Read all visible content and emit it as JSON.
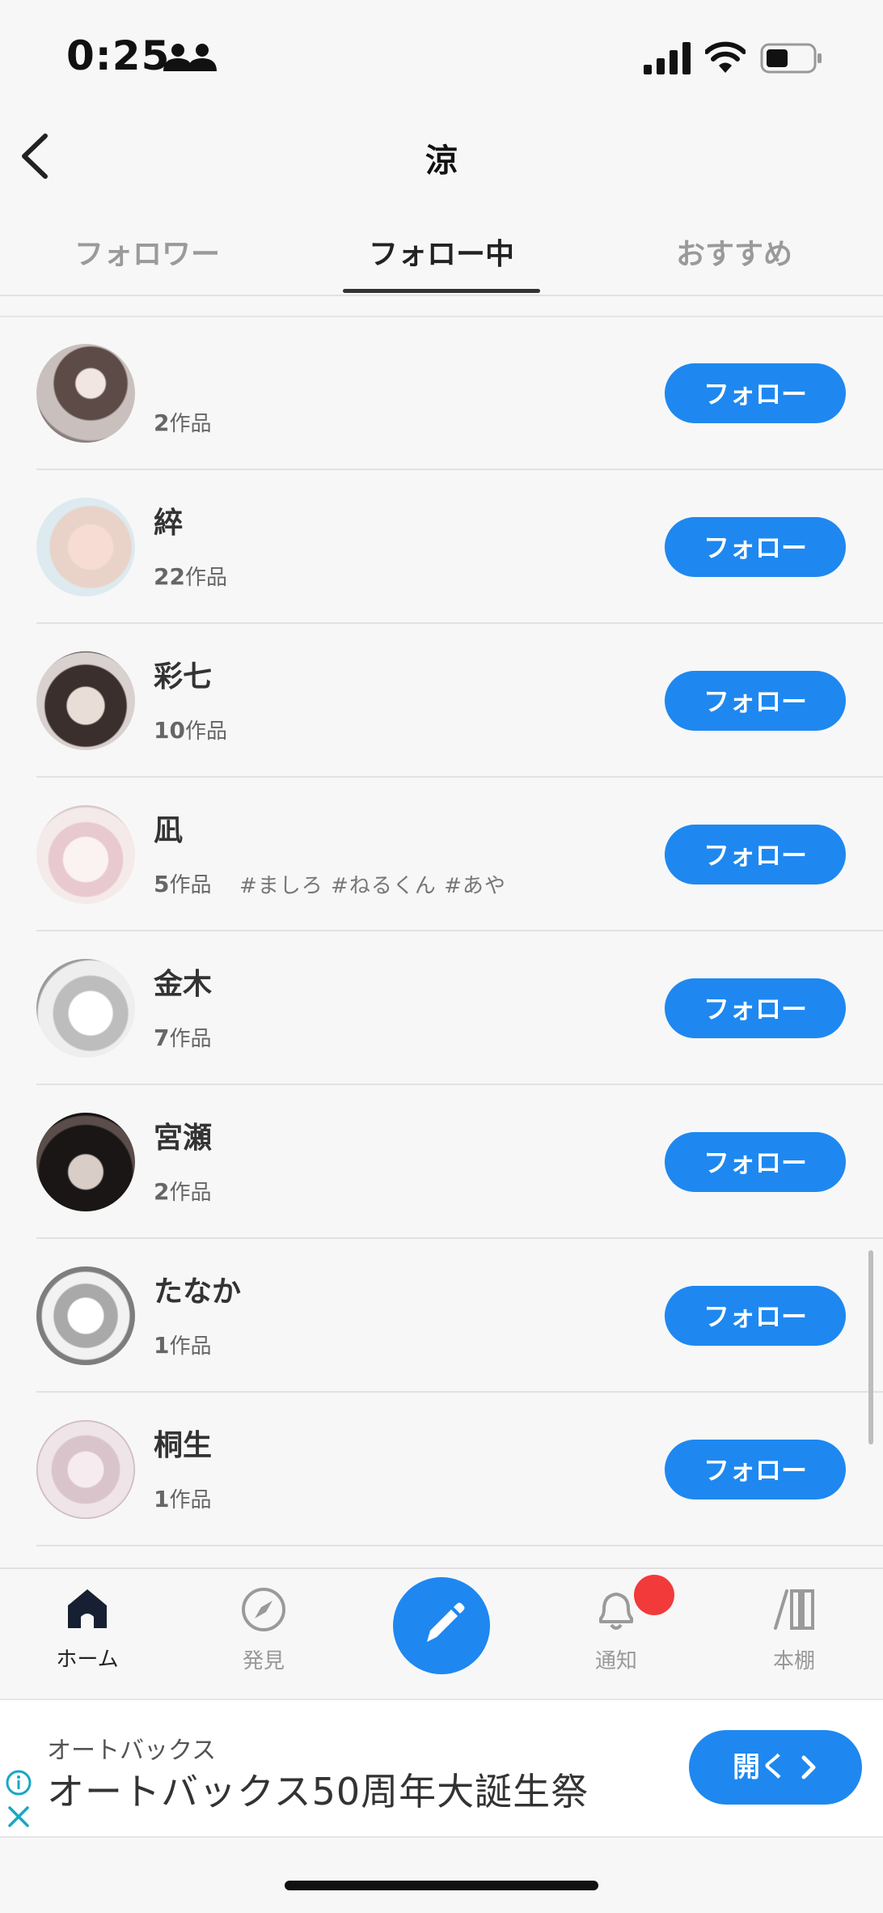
{
  "status_bar": {
    "time": "0:25"
  },
  "header": {
    "title": "涼"
  },
  "tabs": [
    {
      "label": "フォロワー",
      "active": false
    },
    {
      "label": "フォロー中",
      "active": true
    },
    {
      "label": "おすすめ",
      "active": false
    }
  ],
  "users": [
    {
      "name": "",
      "works_count": "2",
      "works_suffix": "作品",
      "tags": "",
      "button": "フォロー"
    },
    {
      "name": "綷",
      "works_count": "22",
      "works_suffix": "作品",
      "tags": "",
      "button": "フォロー"
    },
    {
      "name": "彩七",
      "works_count": "10",
      "works_suffix": "作品",
      "tags": "",
      "button": "フォロー"
    },
    {
      "name": "凪",
      "works_count": "5",
      "works_suffix": "作品",
      "tags": "#ましろ #ねるくん #あや",
      "button": "フォロー"
    },
    {
      "name": "金木",
      "works_count": "7",
      "works_suffix": "作品",
      "tags": "",
      "button": "フォロー"
    },
    {
      "name": "宮瀬",
      "works_count": "2",
      "works_suffix": "作品",
      "tags": "",
      "button": "フォロー"
    },
    {
      "name": "たなか",
      "works_count": "1",
      "works_suffix": "作品",
      "tags": "",
      "button": "フォロー"
    },
    {
      "name": "桐生",
      "works_count": "1",
      "works_suffix": "作品",
      "tags": "",
      "button": "フォロー"
    }
  ],
  "bottom_nav": {
    "home": "ホーム",
    "discover": "発見",
    "notifications": "通知",
    "bookshelf": "本棚"
  },
  "ad": {
    "advertiser": "オートバックス",
    "headline": "オートバックス50周年大誕生祭",
    "cta": "開く"
  },
  "colors": {
    "accent": "#1e88f0",
    "badge": "#f23a3a"
  }
}
